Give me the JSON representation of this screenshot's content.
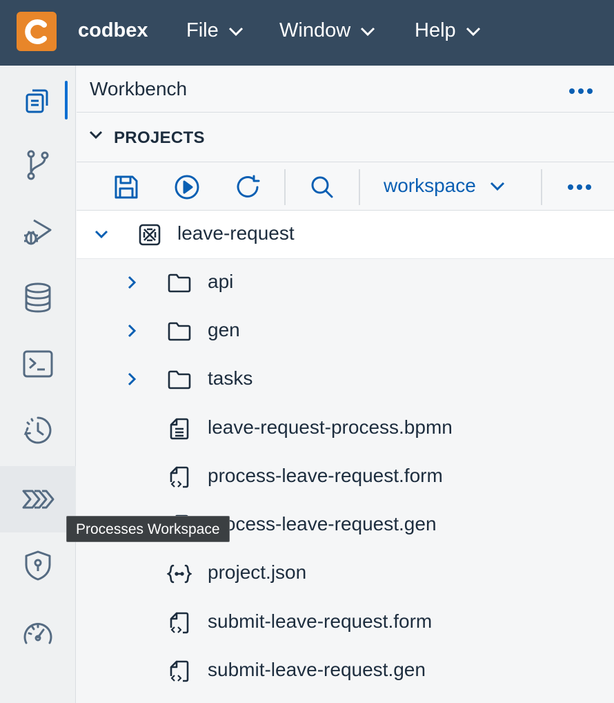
{
  "header": {
    "brand": "codbex",
    "menus": [
      {
        "label": "File"
      },
      {
        "label": "Window"
      },
      {
        "label": "Help"
      }
    ]
  },
  "activity_bar": {
    "items": [
      "workbench-icon",
      "git-branch-icon",
      "debug-icon",
      "database-icon",
      "terminal-icon",
      "history-icon",
      "processes-icon",
      "security-icon",
      "performance-icon"
    ],
    "active": "workbench-icon",
    "hovered": "processes-icon"
  },
  "tooltip": {
    "text": "Processes Workspace"
  },
  "panel": {
    "title": "Workbench",
    "section_title": "PROJECTS",
    "toolbar": {
      "buttons": [
        "save-icon",
        "run-icon",
        "refresh-icon",
        "search-icon"
      ],
      "workspace": "workspace"
    }
  },
  "tree": {
    "project": "leave-request",
    "folders": [
      "api",
      "gen",
      "tasks"
    ],
    "files": [
      {
        "name": "leave-request-process.bpmn",
        "icon": "document-icon"
      },
      {
        "name": "process-leave-request.form",
        "icon": "code-file-icon"
      },
      {
        "name": "process-leave-request.gen",
        "icon": "document-icon"
      },
      {
        "name": "project.json",
        "icon": "json-icon"
      },
      {
        "name": "submit-leave-request.form",
        "icon": "code-file-icon"
      },
      {
        "name": "submit-leave-request.gen",
        "icon": "code-file-icon"
      }
    ]
  },
  "colors": {
    "header_bg": "#354a5f",
    "logo_bg": "#e8862a",
    "accent": "#0a6ed1",
    "tooltip_bg": "#3b3f42"
  }
}
